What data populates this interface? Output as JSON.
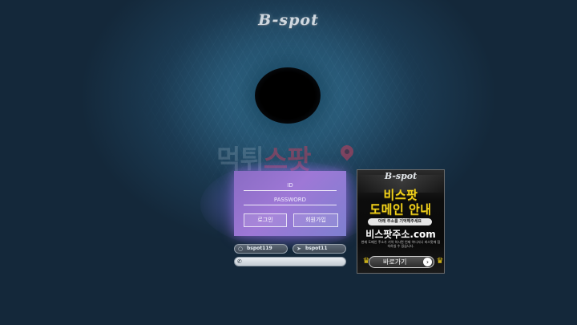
{
  "site": {
    "logo_text": "B-spot"
  },
  "watermark": {
    "part1": "먹튀",
    "part2": "스팟"
  },
  "login": {
    "id_placeholder": "ID",
    "password_placeholder": "PASSWORD",
    "login_label": "로그인",
    "signup_label": "회원가입"
  },
  "contacts": [
    {
      "label": "bspot119",
      "icon": "chat-icon"
    },
    {
      "label": "bspot11",
      "icon": "telegram-icon"
    }
  ],
  "search": {
    "placeholder": "",
    "icon": "phone-icon"
  },
  "banner": {
    "logo_text": "B-spot",
    "title_line1": "비스팟",
    "title_line2": "도메인 안내",
    "notice": "아래 주소를 기억해주세요",
    "domain": "비스팟주소.com",
    "description": "현재 도메인 주소가 기억 하시면 언제 어디서나 비스팟에 접속하실 수 있습니다.",
    "button_label": "바로가기",
    "accent_color": "#f2d21c"
  }
}
